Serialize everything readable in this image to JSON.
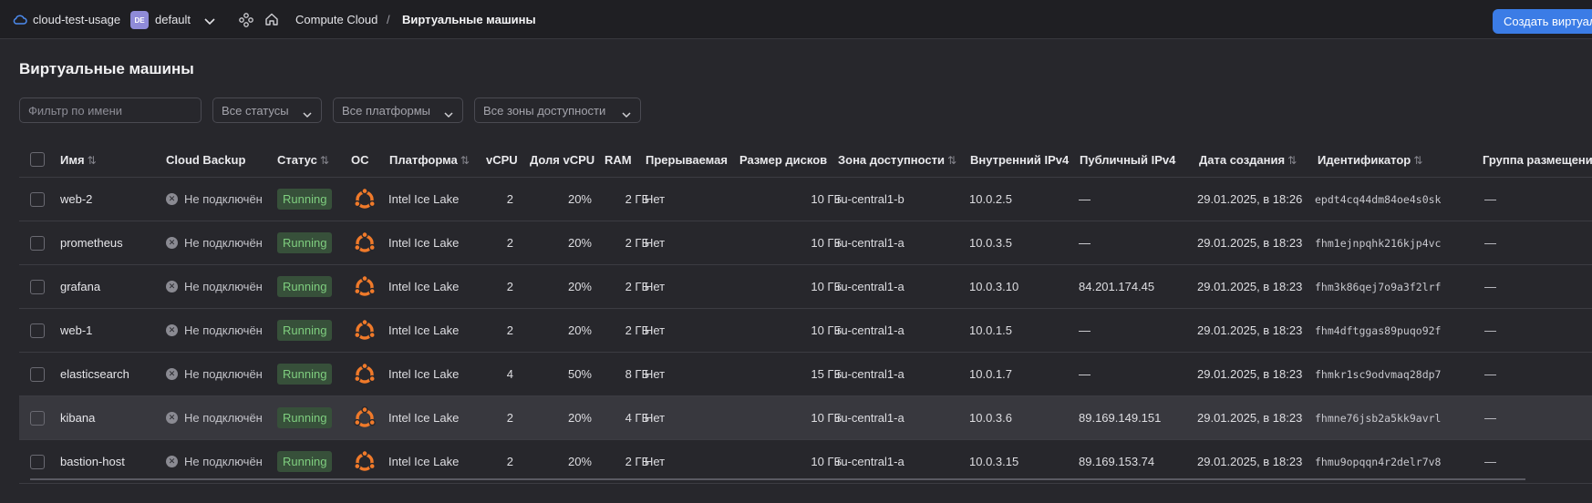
{
  "topbar": {
    "cloud_name": "cloud-test-usage",
    "folder_badge": "DE",
    "folder_name": "default",
    "breadcrumb": [
      "Compute Cloud",
      "/",
      "Виртуальные машины"
    ],
    "create_button": "Создать виртуальную машину",
    "accent": "#3b7ce6"
  },
  "page": {
    "title": "Виртуальные машины"
  },
  "filters": {
    "name_placeholder": "Фильтр по имени",
    "status": "Все статусы",
    "platform": "Все платформы",
    "zone": "Все зоны доступности"
  },
  "columns": {
    "name": "Имя",
    "backup": "Cloud Backup",
    "status": "Статус",
    "os": "ОС",
    "platform": "Платформа",
    "vcpu": "vCPU",
    "share": "Доля vCPU",
    "ram": "RAM",
    "preempt": "Прерываемая",
    "disk": "Размер дисков",
    "zone": "Зона доступности",
    "ip": "Внутренний IPv4",
    "pubip": "Публичный IPv4",
    "date": "Дата создания",
    "id": "Идентификатор",
    "group": "Группа размещения"
  },
  "rows": [
    {
      "name": "web-2",
      "backup": "Не подключён",
      "status": "Running",
      "os": "ubuntu-icon",
      "platform": "Intel Ice Lake",
      "vcpu": "2",
      "share": "20%",
      "ram": "2 ГБ",
      "preempt": "Нет",
      "disk": "10 ГБ",
      "zone": "ru-central1-b",
      "ip": "10.0.2.5",
      "pubip": "—",
      "date": "29.01.2025, в 18:26",
      "id": "epdt4cq44dm84oe4s0sk",
      "group": "—"
    },
    {
      "name": "prometheus",
      "backup": "Не подключён",
      "status": "Running",
      "os": "ubuntu-icon",
      "platform": "Intel Ice Lake",
      "vcpu": "2",
      "share": "20%",
      "ram": "2 ГБ",
      "preempt": "Нет",
      "disk": "10 ГБ",
      "zone": "ru-central1-a",
      "ip": "10.0.3.5",
      "pubip": "—",
      "date": "29.01.2025, в 18:23",
      "id": "fhm1ejnpqhk216kjp4vc",
      "group": "—"
    },
    {
      "name": "grafana",
      "backup": "Не подключён",
      "status": "Running",
      "os": "ubuntu-icon",
      "platform": "Intel Ice Lake",
      "vcpu": "2",
      "share": "20%",
      "ram": "2 ГБ",
      "preempt": "Нет",
      "disk": "10 ГБ",
      "zone": "ru-central1-a",
      "ip": "10.0.3.10",
      "pubip": "84.201.174.45",
      "date": "29.01.2025, в 18:23",
      "id": "fhm3k86qej7o9a3f2lrf",
      "group": "—"
    },
    {
      "name": "web-1",
      "backup": "Не подключён",
      "status": "Running",
      "os": "ubuntu-icon",
      "platform": "Intel Ice Lake",
      "vcpu": "2",
      "share": "20%",
      "ram": "2 ГБ",
      "preempt": "Нет",
      "disk": "10 ГБ",
      "zone": "ru-central1-a",
      "ip": "10.0.1.5",
      "pubip": "—",
      "date": "29.01.2025, в 18:23",
      "id": "fhm4dftggas89puqo92f",
      "group": "—"
    },
    {
      "name": "elasticsearch",
      "backup": "Не подключён",
      "status": "Running",
      "os": "ubuntu-icon",
      "platform": "Intel Ice Lake",
      "vcpu": "4",
      "share": "50%",
      "ram": "8 ГБ",
      "preempt": "Нет",
      "disk": "15 ГБ",
      "zone": "ru-central1-a",
      "ip": "10.0.1.7",
      "pubip": "—",
      "date": "29.01.2025, в 18:23",
      "id": "fhmkr1sc9odvmaq28dp7",
      "group": "—"
    },
    {
      "name": "kibana",
      "backup": "Не подключён",
      "status": "Running",
      "os": "ubuntu-icon",
      "platform": "Intel Ice Lake",
      "vcpu": "2",
      "share": "20%",
      "ram": "4 ГБ",
      "preempt": "Нет",
      "disk": "10 ГБ",
      "zone": "ru-central1-a",
      "ip": "10.0.3.6",
      "pubip": "89.169.149.151",
      "date": "29.01.2025, в 18:23",
      "id": "fhmne76jsb2a5kk9avrl",
      "group": "—"
    },
    {
      "name": "bastion-host",
      "backup": "Не подключён",
      "status": "Running",
      "os": "ubuntu-icon",
      "platform": "Intel Ice Lake",
      "vcpu": "2",
      "share": "20%",
      "ram": "2 ГБ",
      "preempt": "Нет",
      "disk": "10 ГБ",
      "zone": "ru-central1-a",
      "ip": "10.0.3.15",
      "pubip": "89.169.153.74",
      "date": "29.01.2025, в 18:23",
      "id": "fhmu9opqqn4r2delr7v8",
      "group": "—"
    }
  ]
}
